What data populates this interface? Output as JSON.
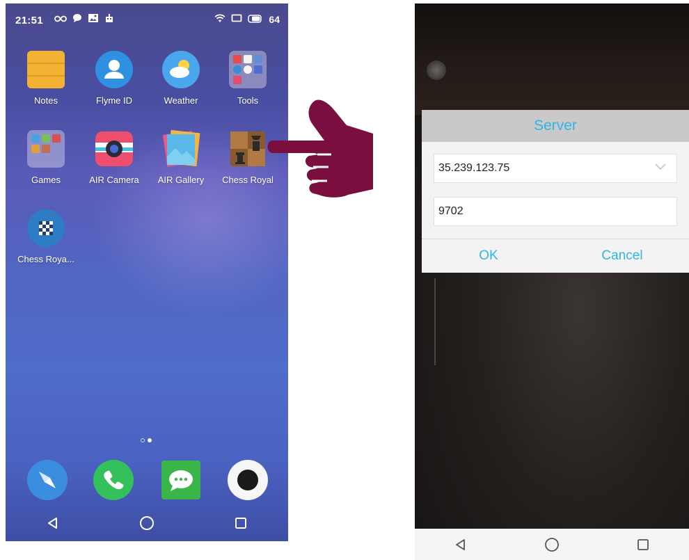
{
  "left_phone": {
    "status_bar": {
      "time": "21:51",
      "left_icons": [
        "infinity-icon",
        "chat-bubble-icon",
        "image-box-icon",
        "robot-icon"
      ],
      "right_icons": [
        "wifi-icon",
        "screen-icon",
        "battery-icon"
      ],
      "battery_level": "64"
    },
    "apps": [
      {
        "label": "Notes",
        "icon": "notes-icon"
      },
      {
        "label": "Flyme ID",
        "icon": "flyme-id-icon"
      },
      {
        "label": "Weather",
        "icon": "weather-icon"
      },
      {
        "label": "Tools",
        "icon": "tools-folder-icon"
      },
      {
        "label": "Games",
        "icon": "games-folder-icon"
      },
      {
        "label": "AIR Camera",
        "icon": "air-camera-icon"
      },
      {
        "label": "AIR Gallery",
        "icon": "air-gallery-icon"
      },
      {
        "label": "Chess Royal",
        "icon": "chess-royal-icon"
      },
      {
        "label": "Chess Roya...",
        "icon": "chess-royal-checker-icon"
      }
    ],
    "page_indicator": {
      "pages": 2,
      "active": 2
    },
    "dock": [
      "compass-icon",
      "phone-icon",
      "messages-icon",
      "camera-icon"
    ],
    "nav": [
      "back-icon",
      "home-icon",
      "recents-icon"
    ]
  },
  "right_phone": {
    "dialog": {
      "title": "Server",
      "server_address": "35.239.123.75",
      "port": "9702",
      "ok_label": "OK",
      "cancel_label": "Cancel"
    },
    "nav": [
      "back-icon",
      "home-icon",
      "recents-icon"
    ]
  },
  "colors": {
    "accent": "#2fb6e6",
    "pointer": "#7a0e3e"
  }
}
